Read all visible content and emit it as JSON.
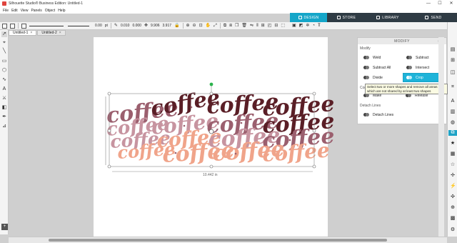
{
  "window": {
    "title": "Silhouette Studio® Business Edition: Untitled-1",
    "min_glyph": "—",
    "max_glyph": "☐",
    "close_glyph": "✕"
  },
  "menu": [
    "File",
    "Edit",
    "View",
    "Panels",
    "Object",
    "Help"
  ],
  "mode_tabs": [
    {
      "label": "DESIGN",
      "active": true
    },
    {
      "label": "STORE",
      "active": false
    },
    {
      "label": "LIBRARY",
      "active": false
    },
    {
      "label": "SEND",
      "active": false
    }
  ],
  "toolbar": {
    "line_width": "0.00",
    "unit": "pt",
    "w_value": "0.010",
    "h_value": "0.000",
    "width_value": "9.906",
    "height_value": "3.917"
  },
  "doc_tabs": [
    {
      "label": "Untitled-1",
      "close": "×"
    },
    {
      "label": "Untitled-2",
      "close": "×"
    }
  ],
  "panel": {
    "title": "MODIFY",
    "buttons_glyph": "≡ ✕",
    "modify_label": "Modify",
    "modify_buttons": [
      "Weld",
      "Subtract",
      "Subtract All",
      "Intersect",
      "Divide",
      "Crop"
    ],
    "compound_label": "Compound Paths",
    "compound_buttons": [
      "Make",
      "Release"
    ],
    "detach_label": "Detach Lines",
    "detach_button": "Detach Lines"
  },
  "tooltip": "Select two or more shapes and remove all areas which are not shared by at least two shapes",
  "design": {
    "word": "Coffee",
    "dimension_label": "10.442 in",
    "colors": {
      "dark": "#5a1e26",
      "mid": "#9b5f6e",
      "light": "#c794a0",
      "peach": "#f0a48a",
      "accent": "#1fa3c6"
    }
  },
  "colors": {
    "accent": "#15a6c9",
    "tab_dark": "#2f3b44",
    "highlight": "#1eb3d9",
    "rotate_handle": "#2bb24c"
  }
}
